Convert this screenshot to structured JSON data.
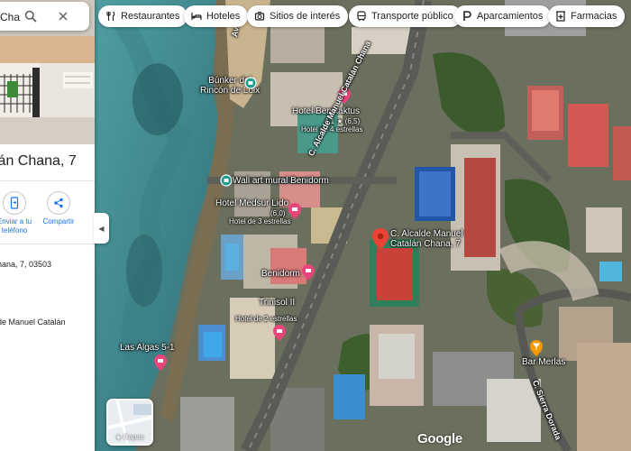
{
  "search": {
    "value": "Chan"
  },
  "place": {
    "title": "lán Chana, 7",
    "address": "hana, 7, 03503",
    "plus_code": "de Manuel Catalán"
  },
  "actions": [
    {
      "label": "Enviar a tu teléfono",
      "icon": "phone-send-icon"
    },
    {
      "label": "Compartir",
      "icon": "share-icon"
    }
  ],
  "chips": [
    {
      "label": "Restaurantes",
      "icon": "restaurant-icon"
    },
    {
      "label": "Hoteles",
      "icon": "hotel-icon"
    },
    {
      "label": "Sitios de interés",
      "icon": "attraction-icon"
    },
    {
      "label": "Transporte público",
      "icon": "transit-icon"
    },
    {
      "label": "Aparcamientos",
      "icon": "parking-icon"
    },
    {
      "label": "Farmacias",
      "icon": "pharmacy-icon"
    }
  ],
  "map_labels": {
    "bunker_line1": "Búnker del",
    "bunker_line2": "Rincón de Loix",
    "benikaktus": "Hotel Benikaktus",
    "benikaktus_rating": "4,1 ★ (6,5)",
    "benikaktus_sub": "Hotel de 4 estrellas",
    "wall_art": "Wall art mural Benidorm",
    "medsur": "Hotel Medsur Lido",
    "medsur_rating": "(6,0)",
    "medsur_sub": "Hotel de 3 estrellas",
    "benidorm": "Benidorm",
    "trinisol": "Trinisol II",
    "trinisol_sub": "Hotel de 2 estrellas",
    "las_algas": "Las Algas 5-1",
    "bar_merlas": "Bar Merlas",
    "street_alcalde": "C. Alcalde Manuel Catalán Chana",
    "street_sierra": "C. Sierra Dorada",
    "street_av": "Av.",
    "selected_line1": "C. Alcalde Manuel",
    "selected_line2": "Catalán Chana, 7"
  },
  "layers_label": "Capas",
  "google_logo": "Google",
  "colors": {
    "accent": "#1a73e8",
    "pin_red": "#ea4335",
    "pin_pink": "#e8457a",
    "pin_orange": "#f29900",
    "pin_teal": "#1f9d8f"
  }
}
